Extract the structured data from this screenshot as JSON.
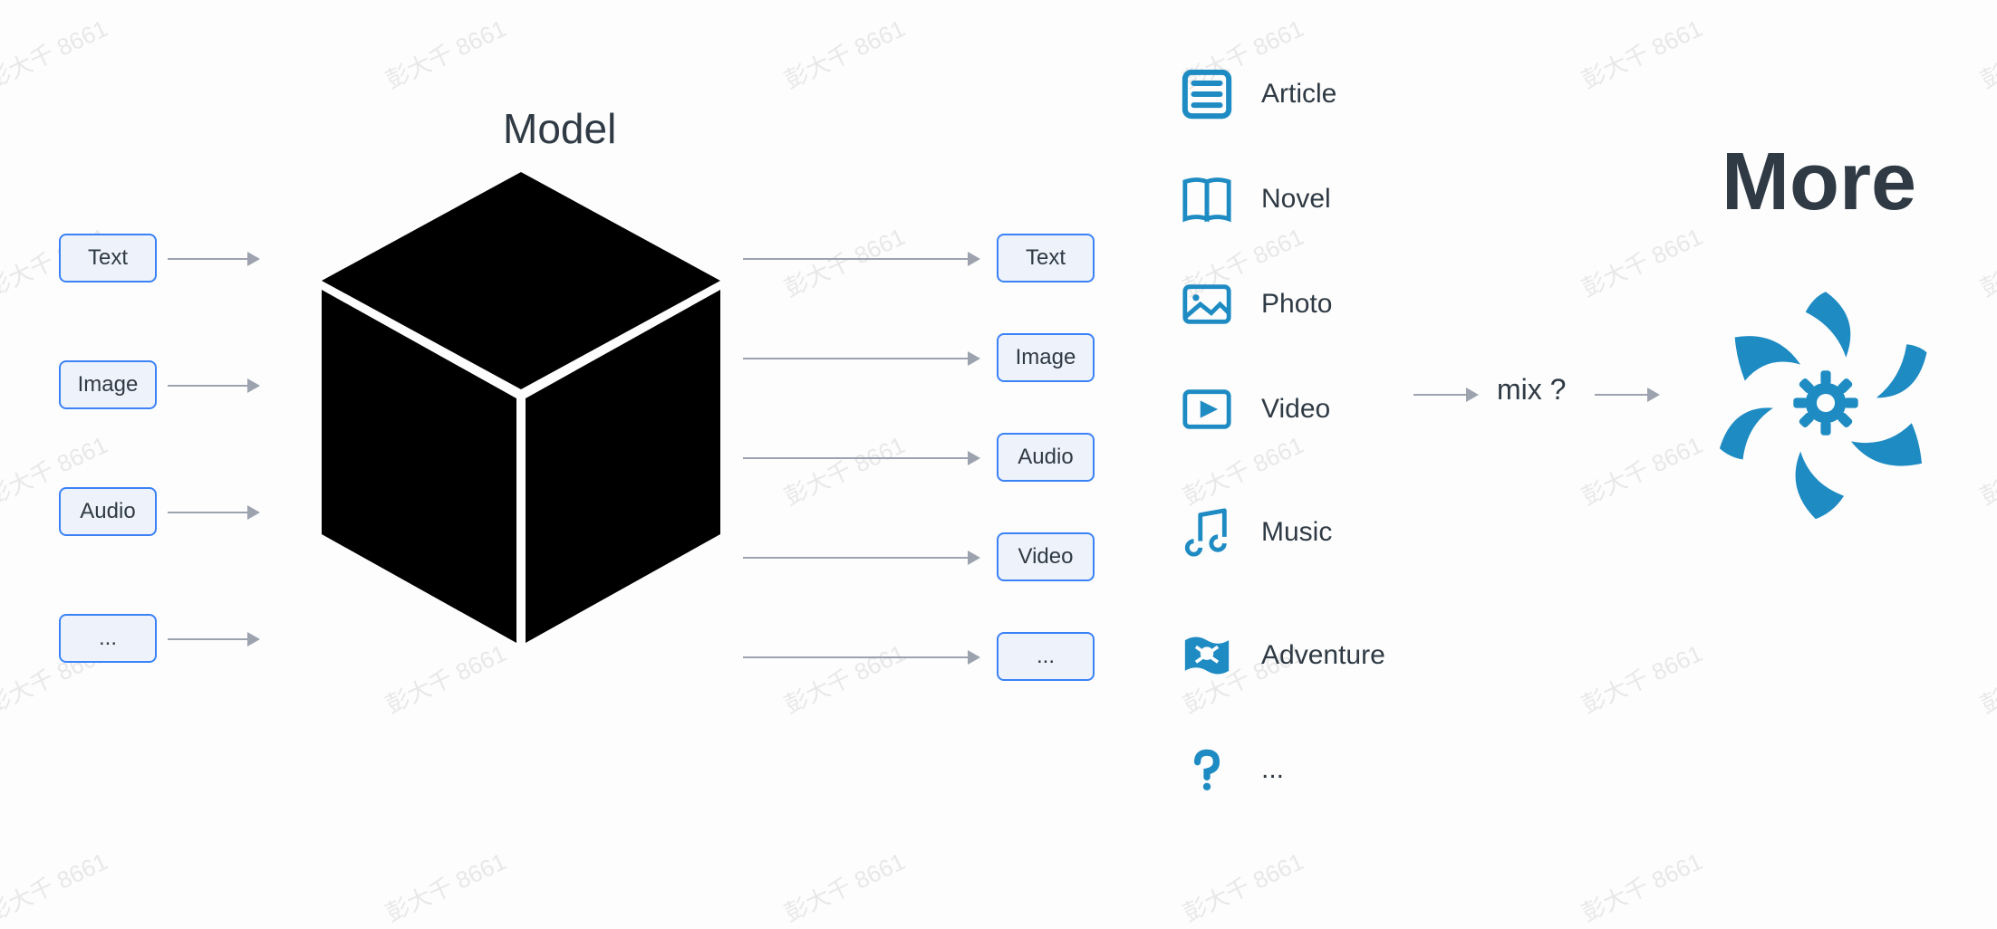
{
  "watermark_text": "彭大千 8661",
  "model_title": "Model",
  "inputs": [
    {
      "label": "Text"
    },
    {
      "label": "Image"
    },
    {
      "label": "Audio"
    },
    {
      "label": "..."
    }
  ],
  "outputs": [
    {
      "label": "Text"
    },
    {
      "label": "Image"
    },
    {
      "label": "Audio"
    },
    {
      "label": "Video"
    },
    {
      "label": "..."
    }
  ],
  "content_types": [
    {
      "icon": "article",
      "label": "Article"
    },
    {
      "icon": "novel",
      "label": "Novel"
    },
    {
      "icon": "photo",
      "label": "Photo"
    },
    {
      "icon": "video",
      "label": "Video"
    },
    {
      "icon": "music",
      "label": "Music"
    },
    {
      "icon": "adventure",
      "label": "Adventure"
    },
    {
      "icon": "question",
      "label": "..."
    }
  ],
  "mix_label": "mix ?",
  "more_title": "More",
  "colors": {
    "accent": "#1e8bc3",
    "pill_border": "#3b82f6",
    "pill_bg": "#eef2fb",
    "arrow": "#9ca3af",
    "text": "#2f3a44",
    "cube": "#000000"
  }
}
